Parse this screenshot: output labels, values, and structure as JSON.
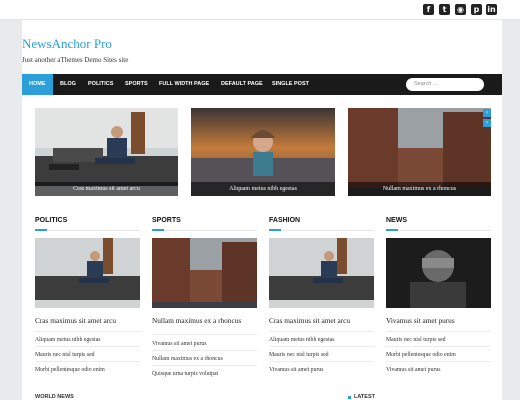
{
  "social": {
    "icons": [
      "facebook-icon",
      "twitter-icon",
      "instagram-icon",
      "pinterest-icon",
      "linkedin-icon"
    ],
    "glyphs": [
      "f",
      "t",
      "◉",
      "p",
      "in"
    ]
  },
  "header": {
    "site_title": "NewsAnchor Pro",
    "site_description": "Just another aThemes Demo Sites site"
  },
  "nav": {
    "items": [
      "HOME",
      "BLOG",
      "POLITICS",
      "SPORTS",
      "FULL WIDTH PAGE",
      "DEFAULT PAGE",
      "SINGLE POST"
    ],
    "active_index": 0,
    "search_placeholder": "Search ..."
  },
  "slider": {
    "slides": [
      {
        "caption": "Cras maximus sit amet arcu"
      },
      {
        "caption": "Aliquam metus nibh egestas"
      },
      {
        "caption": "Nullam maximus ex a rhoncus"
      }
    ],
    "controls": [
      "‹",
      "›"
    ]
  },
  "columns": [
    {
      "title": "POLITICS",
      "post_title": "Cras maximus sit amet arcu",
      "links": [
        "Aliquam metus nibh egestas",
        "Mauris nec nisl turpis sed",
        "Morbi pellentesque odio enim"
      ]
    },
    {
      "title": "SPORTS",
      "post_title": "Nullam maximus ex a rhoncus",
      "links": [
        "Vivamus sit amet purus",
        "Nullam maximus ex a rhoncus",
        "Quisque urna turpis volutpat"
      ]
    },
    {
      "title": "FASHION",
      "post_title": "Cras maximus sit amet arcu",
      "links": [
        "Aliquam metus nibh egestas",
        "Mauris nec nisl turpis sed",
        "Vivamus sit amet purus"
      ]
    },
    {
      "title": "NEWS",
      "post_title": "Vivamus sit amet purus",
      "links": [
        "Mauris nec nisl turpis sed",
        "Morbi pellentesque odio enim",
        "Vivamus sit amet purus"
      ]
    }
  ],
  "bottom": {
    "left_label": "WORLD NEWS",
    "right_label": "LATEST"
  },
  "colors": {
    "accent": "#2a9fd8",
    "nav_bg": "#1a1a1a"
  }
}
